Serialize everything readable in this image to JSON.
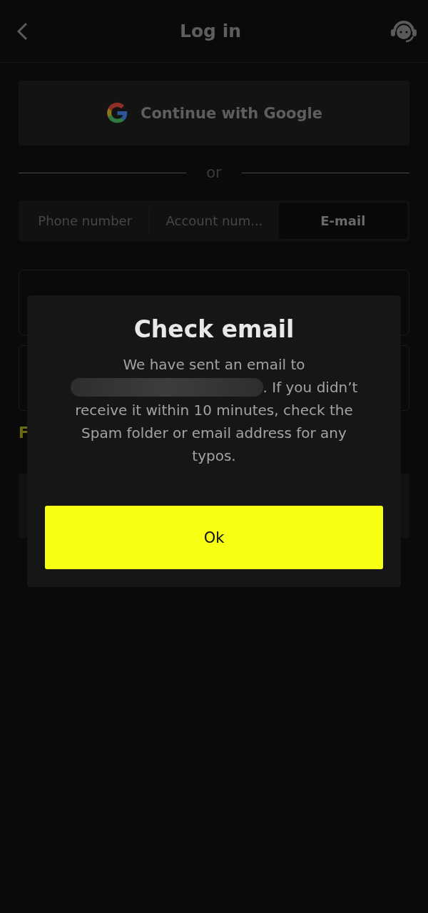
{
  "header": {
    "title": "Log in"
  },
  "google_button": {
    "label": "Continue with Google"
  },
  "divider": {
    "label": "or"
  },
  "tabs": [
    {
      "label": "Phone number",
      "selected": false
    },
    {
      "label": "Account num...",
      "selected": false
    },
    {
      "label": "E-mail",
      "selected": true
    }
  ],
  "fields": [
    {
      "kind": "input"
    },
    {
      "kind": "input"
    }
  ],
  "forgot_link": {
    "label": "F"
  },
  "dialog": {
    "title": "Check email",
    "message_before": "We have sent an email to",
    "message_after": ". If you didn’t",
    "message_rest": "receive it within 10 minutes, check the Spam folder or email address for any typos.",
    "button": "Ok"
  }
}
